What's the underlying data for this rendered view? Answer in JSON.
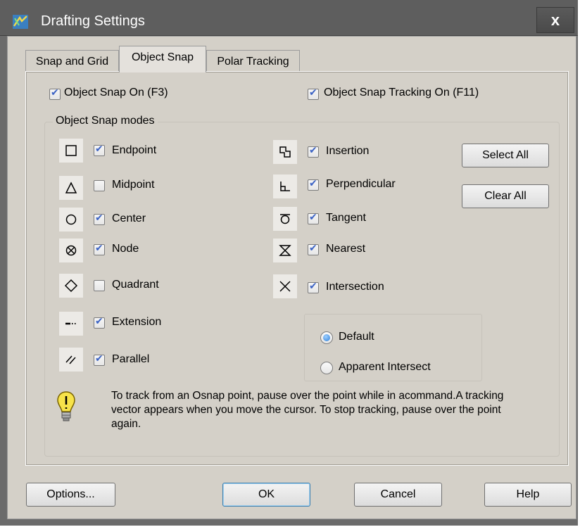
{
  "window": {
    "title": "Drafting Settings",
    "close_label": "x",
    "app_icon": "drafting-settings-app-icon"
  },
  "tabs": [
    {
      "label": "Snap and Grid",
      "active": false
    },
    {
      "label": "Object Snap",
      "active": true
    },
    {
      "label": "Polar Tracking",
      "active": false
    }
  ],
  "top_options": {
    "object_snap_on": {
      "label": "Object Snap On (F3)",
      "checked": true
    },
    "object_snap_tracking": {
      "label": "Object Snap Tracking On (F11)",
      "checked": true
    }
  },
  "modes_group": {
    "title": "Object Snap modes"
  },
  "modes_left": [
    {
      "label": "Endpoint",
      "checked": true,
      "icon": "endpoint-square-icon"
    },
    {
      "label": "Midpoint",
      "checked": false,
      "icon": "midpoint-triangle-icon"
    },
    {
      "label": "Center",
      "checked": true,
      "icon": "center-circle-icon"
    },
    {
      "label": "Node",
      "checked": true,
      "icon": "node-icon"
    },
    {
      "label": "Quadrant",
      "checked": false,
      "icon": "quadrant-diamond-icon"
    },
    {
      "label": "Extension",
      "checked": true,
      "icon": "extension-icon"
    },
    {
      "label": "Parallel",
      "checked": true,
      "icon": "parallel-icon"
    }
  ],
  "modes_right": [
    {
      "label": "Insertion",
      "checked": true,
      "icon": "insertion-icon"
    },
    {
      "label": "Perpendicular",
      "checked": true,
      "icon": "perpendicular-icon"
    },
    {
      "label": "Tangent",
      "checked": true,
      "icon": "tangent-icon"
    },
    {
      "label": "Nearest",
      "checked": true,
      "icon": "nearest-hourglass-icon"
    },
    {
      "label": "Intersection",
      "checked": true,
      "icon": "intersection-x-icon"
    }
  ],
  "buttons_side": {
    "select_all": "Select All",
    "clear_all": "Clear All"
  },
  "intersection_mode": {
    "options": [
      {
        "label": "Default",
        "selected": true
      },
      {
        "label": "Apparent Intersect",
        "selected": false
      }
    ]
  },
  "hint": {
    "icon": "lightbulb-icon",
    "text": "To track from an Osnap point, pause over the point while in acommand.A tracking vector appears when you move the cursor.  To stop tracking, pause over the point again."
  },
  "footer": {
    "options": "Options...",
    "ok": "OK",
    "cancel": "Cancel",
    "help": "Help"
  },
  "colors": {
    "titlebar": "#5e5e5e",
    "dialog": "#d4d0c8",
    "check": "#3c63c4",
    "radio": "#2f7fd8"
  }
}
